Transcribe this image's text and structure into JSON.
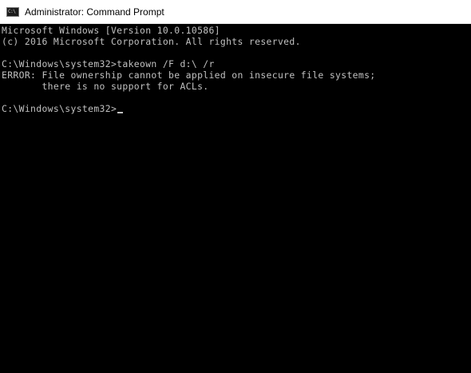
{
  "window": {
    "title": "Administrator: Command Prompt",
    "icon": "cmd-icon",
    "icon_text": "C:\\"
  },
  "console": {
    "lines": [
      "Microsoft Windows [Version 10.0.10586]",
      "(c) 2016 Microsoft Corporation. All rights reserved.",
      "",
      "C:\\Windows\\system32>takeown /F d:\\ /r",
      "ERROR: File ownership cannot be applied on insecure file systems;",
      "       there is no support for ACLs.",
      "",
      "C:\\Windows\\system32>"
    ]
  },
  "colors": {
    "background": "#000000",
    "text": "#c0c0c0",
    "titlebar": "#ffffff"
  }
}
